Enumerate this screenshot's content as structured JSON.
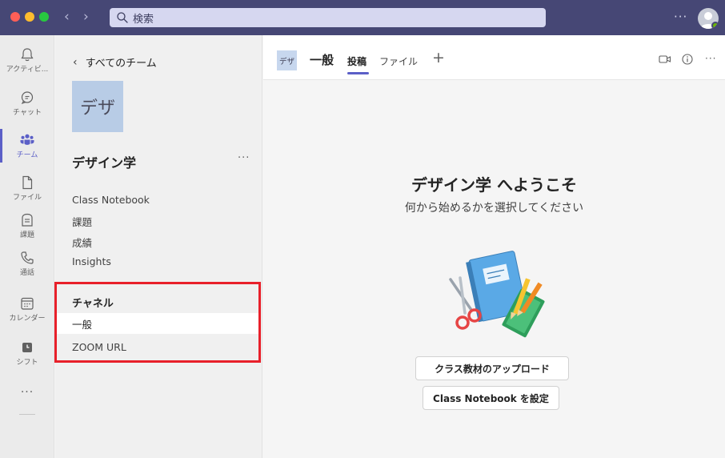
{
  "titlebar": {
    "search_placeholder": "検索",
    "more": "···",
    "colors": {
      "bar": "#464775",
      "search_bg": "#d6d7f0"
    }
  },
  "appbar": {
    "items": [
      {
        "icon": "bell-icon",
        "label": "アクティビ..."
      },
      {
        "icon": "chat-icon",
        "label": "チャット"
      },
      {
        "icon": "teams-icon",
        "label": "チーム",
        "active": true
      },
      {
        "icon": "file-icon",
        "label": "ファイル"
      },
      {
        "icon": "assignments-icon",
        "label": "課題"
      },
      {
        "icon": "phone-icon",
        "label": "通話"
      },
      {
        "icon": "calendar-icon",
        "label": "カレンダー"
      },
      {
        "icon": "shifts-icon",
        "label": "シフト"
      }
    ],
    "more": "···"
  },
  "team_panel": {
    "back_label": "すべてのチーム",
    "team_avatar_text": "デザ",
    "team_name": "デザイン学",
    "team_more": "···",
    "links": [
      "Class Notebook",
      "課題",
      "成績",
      "Insights"
    ],
    "channels_header": "チャネル",
    "channels": [
      "一般",
      "ZOOM URL"
    ]
  },
  "channel_header": {
    "avatar_text": "デザ",
    "title": "一般",
    "tabs": [
      "投稿",
      "ファイル"
    ],
    "add_tab": "+",
    "more": "···"
  },
  "main": {
    "welcome_title": "デザイン学 へようこそ",
    "welcome_subtitle": "何から始めるかを選択してください",
    "buttons": [
      "クラス教材のアップロード",
      "Class Notebook を設定"
    ]
  },
  "accent_color": "#5b5fc7",
  "highlight_color": "#e8202a"
}
